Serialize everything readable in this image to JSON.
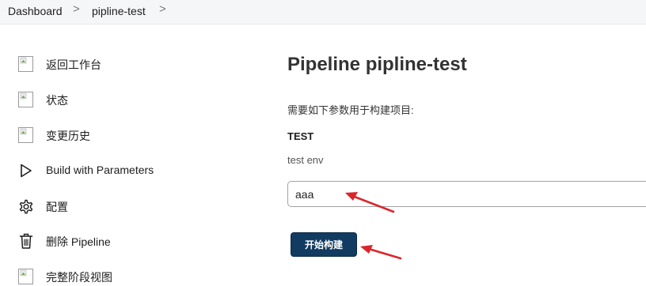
{
  "breadcrumb": {
    "items": [
      "Dashboard",
      "pipline-test"
    ],
    "separator": ">"
  },
  "sidebar": {
    "items": [
      {
        "label": "返回工作台",
        "icon": "broken-image-icon"
      },
      {
        "label": "状态",
        "icon": "broken-image-icon"
      },
      {
        "label": "变更历史",
        "icon": "broken-image-icon"
      },
      {
        "label": "Build with Parameters",
        "icon": "play-icon"
      },
      {
        "label": "配置",
        "icon": "gear-icon"
      },
      {
        "label": "删除 Pipeline",
        "icon": "trash-icon"
      },
      {
        "label": "完整阶段视图",
        "icon": "broken-image-icon"
      }
    ]
  },
  "main": {
    "title": "Pipeline pipline-test",
    "intro": "需要如下参数用于构建项目:",
    "param": {
      "name": "TEST",
      "description": "test env",
      "value": "aaa"
    },
    "build_button": "开始构建"
  },
  "colors": {
    "accent": "#123b61",
    "annotation_arrow": "#d9262c"
  }
}
